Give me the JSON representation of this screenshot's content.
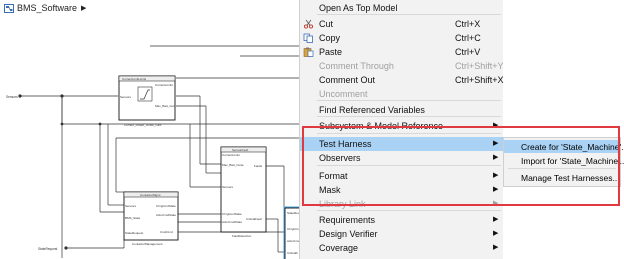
{
  "breadcrumb": {
    "model_name": "BMS_Software",
    "icon": "model-icon"
  },
  "diagram": {
    "labels": {
      "sensors": "Sensors",
      "state_request": "StateRequest",
      "block1_title": "CurrentLimitLimits",
      "block1_in": "Sensors",
      "block1_out1": "CurrentLimits",
      "block1_out2": "Max_Batt_Curr",
      "block1_name": "Current_Power_Limits_Calc",
      "block2_title": "SensorFault",
      "block2_in1": "CurrentLimits",
      "block2_in2": "Max_Batt_Code",
      "block2_in3": "Sensors",
      "block2_in4": "ChrgCmdState",
      "block2_in5": "AcknCmdState",
      "block2_out1": "Faults",
      "block2_out2": "CriticalFault",
      "block2_name": "FaultDetection",
      "block3_title": "ContactorMgmt",
      "block3_in1": "Sensors",
      "block3_in2": "BMS_State",
      "block3_in3": "StateRequest",
      "block3_out1": "ChrgCmdState",
      "block3_out2": "AcknCmdState",
      "block3_out3": "CmdCmd",
      "block3_name": "ContactorManagement",
      "block4_in": "StateReq",
      "block4_in2": "CriticalF",
      "block4_out": "ChrgCmd",
      "block4_out2": "AcknCmd"
    }
  },
  "menu": {
    "items": [
      {
        "label": "Open As Top Model",
        "shortcut": "",
        "submenu": false,
        "disabled": false,
        "icon": ""
      },
      {
        "label": "Cut",
        "shortcut": "Ctrl+X",
        "submenu": false,
        "disabled": false,
        "icon": "scissors-icon"
      },
      {
        "label": "Copy",
        "shortcut": "Ctrl+C",
        "submenu": false,
        "disabled": false,
        "icon": "copy-icon"
      },
      {
        "label": "Paste",
        "shortcut": "Ctrl+V",
        "submenu": false,
        "disabled": false,
        "icon": "paste-icon"
      },
      {
        "label": "Comment Through",
        "shortcut": "Ctrl+Shift+Y",
        "submenu": false,
        "disabled": true,
        "icon": ""
      },
      {
        "label": "Comment Out",
        "shortcut": "Ctrl+Shift+X",
        "submenu": false,
        "disabled": false,
        "icon": ""
      },
      {
        "label": "Uncomment",
        "shortcut": "",
        "submenu": false,
        "disabled": true,
        "icon": ""
      },
      {
        "label": "Find Referenced Variables",
        "shortcut": "",
        "submenu": false,
        "disabled": false,
        "icon": ""
      },
      {
        "label": "Subsystem & Model Reference",
        "shortcut": "",
        "submenu": true,
        "disabled": false,
        "icon": ""
      },
      {
        "label": "Test Harness",
        "shortcut": "",
        "submenu": true,
        "disabled": false,
        "icon": "",
        "highlighted": true
      },
      {
        "label": "Observers",
        "shortcut": "",
        "submenu": true,
        "disabled": false,
        "icon": ""
      },
      {
        "label": "Format",
        "shortcut": "",
        "submenu": true,
        "disabled": false,
        "icon": ""
      },
      {
        "label": "Mask",
        "shortcut": "",
        "submenu": true,
        "disabled": false,
        "icon": ""
      },
      {
        "label": "Library Link",
        "shortcut": "",
        "submenu": true,
        "disabled": true,
        "icon": ""
      },
      {
        "label": "Requirements",
        "shortcut": "",
        "submenu": true,
        "disabled": false,
        "icon": ""
      },
      {
        "label": "Design Verifier",
        "shortcut": "",
        "submenu": true,
        "disabled": false,
        "icon": ""
      },
      {
        "label": "Coverage",
        "shortcut": "",
        "submenu": true,
        "disabled": false,
        "icon": ""
      }
    ],
    "submenu_arrow": "▶"
  },
  "submenu": {
    "items": [
      {
        "label": "Create for 'State_Machine'...",
        "highlighted": true
      },
      {
        "label": "Import for 'State_Machine'...",
        "highlighted": false
      },
      {
        "label": "Manage Test Harnesses...",
        "highlighted": false
      }
    ]
  },
  "colors": {
    "highlight": "#a9d2f5",
    "annotation_box": "#e0393f",
    "menu_bg": "#f2f2f2"
  }
}
